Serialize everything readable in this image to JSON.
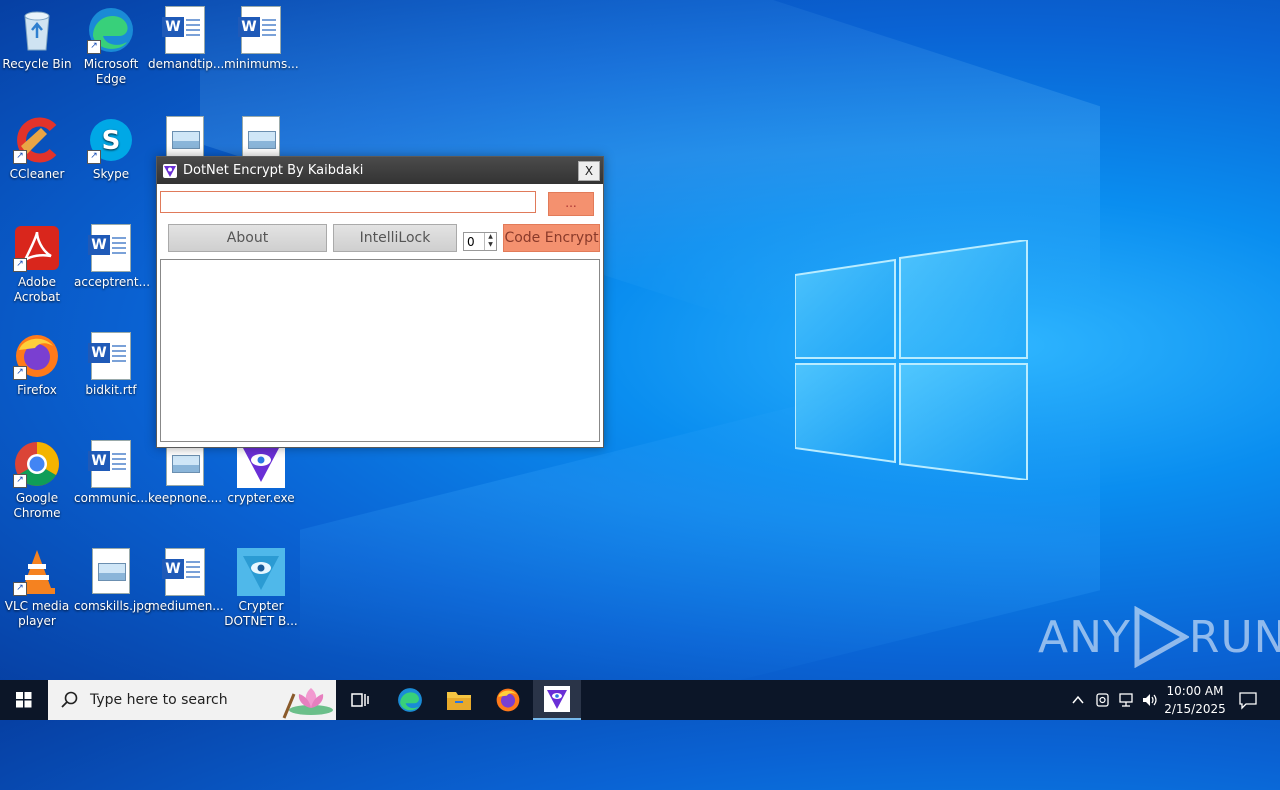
{
  "desktop": {
    "icons": {
      "recycle_bin": "Recycle Bin",
      "edge": "Microsoft Edge",
      "demandtip": "demandtip...",
      "minimums": "minimums...",
      "ccleaner": "CCleaner",
      "skype": "Skype",
      "acrobat": "Adobe Acrobat",
      "acceptrent": "acceptrent...",
      "firefox": "Firefox",
      "bidkit": "bidkit.rtf",
      "chrome": "Google Chrome",
      "communic": "communic...",
      "keepnone": "keepnone....",
      "crypter_exe": "crypter.exe",
      "vlc": "VLC media player",
      "comskills": "comskills.jpg",
      "mediumen": "mediumen...",
      "crypter_dotnet": "Crypter DOTNET B..."
    }
  },
  "window": {
    "title": "DotNet Encrypt By Kaibdaki",
    "close_label": "X",
    "path_value": "",
    "browse_label": "...",
    "about_label": "About",
    "intellilock_label": "IntelliLock",
    "spinner_value": "0",
    "encrypt_label": "Code Encrypt",
    "output_text": ""
  },
  "taskbar": {
    "search_placeholder": "Type here to search",
    "time": "10:00 AM",
    "date": "2/15/2025"
  },
  "watermark": {
    "text_left": "ANY",
    "text_right": "RUN"
  },
  "colors": {
    "accent_orange": "#f4916f",
    "taskbar": "#0c1628"
  }
}
